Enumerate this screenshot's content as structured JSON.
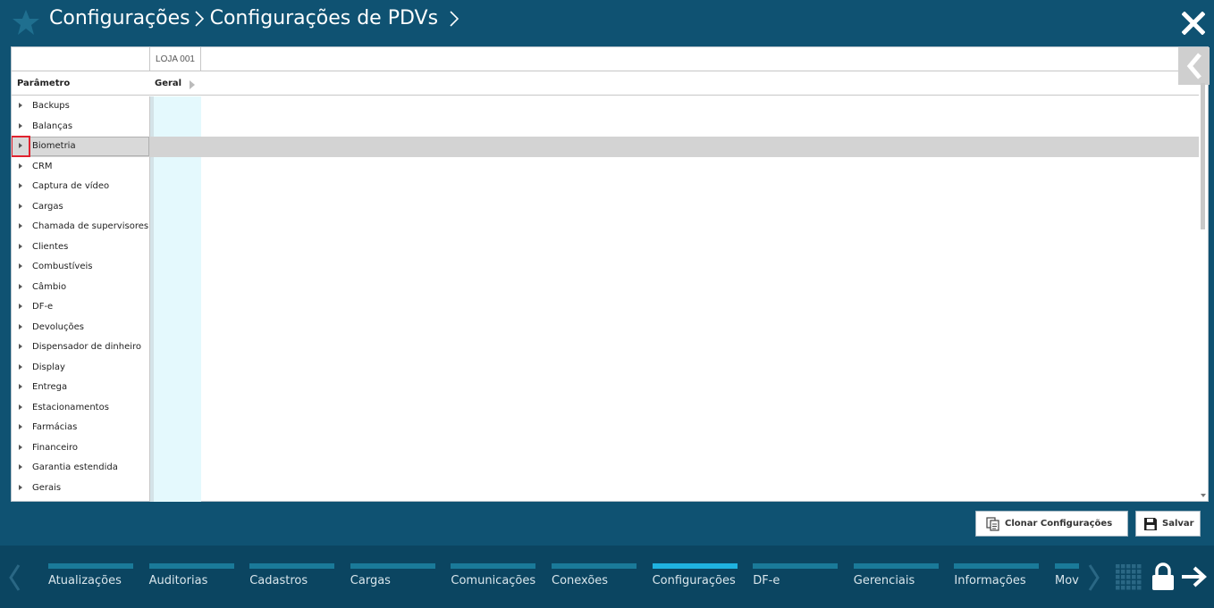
{
  "header": {
    "breadcrumb": [
      "Configurações",
      "Configurações de PDVs"
    ]
  },
  "table": {
    "store_column": "LOJA 001",
    "param_header": "Parâmetro",
    "group_header": "Geral",
    "rows": [
      "Backups",
      "Balanças",
      "Biometria",
      "CRM",
      "Captura de vídeo",
      "Cargas",
      "Chamada de supervisores",
      "Clientes",
      "Combustíveis",
      "Câmbio",
      "DF-e",
      "Devoluções",
      "Dispensador de dinheiro",
      "Display",
      "Entrega",
      "Estacionamentos",
      "Farmácias",
      "Financeiro",
      "Garantia estendida",
      "Gerais"
    ],
    "selected_row": "Biometria"
  },
  "actions": {
    "clone_label": "Clonar Configurações",
    "save_label": "Salvar"
  },
  "nav": {
    "items": [
      "Atualizações",
      "Auditorias",
      "Cadastros",
      "Cargas",
      "Comunicações",
      "Conexões",
      "Configurações",
      "DF-e",
      "Gerenciais",
      "Informações",
      "Mov"
    ],
    "active": "Configurações"
  },
  "colors": {
    "header_bg": "#0f5272",
    "bottom_bg": "#0b4561",
    "nav_bar": "#1a7a99",
    "nav_bar_active": "#1fb2e0",
    "selected_row": "#d3d3d3",
    "highlight": "#e0232f",
    "value_column": "#e4f9fd"
  }
}
